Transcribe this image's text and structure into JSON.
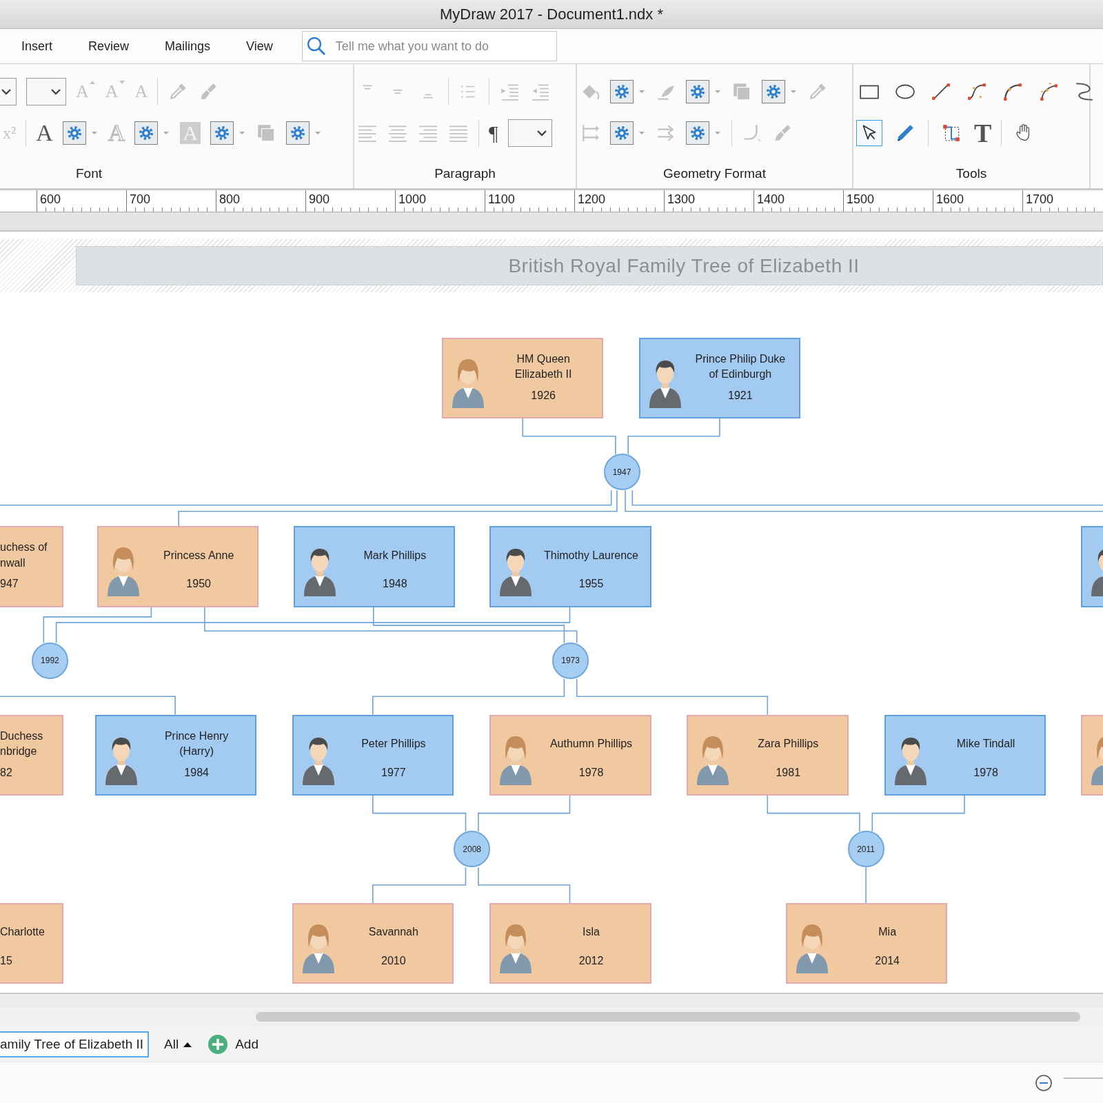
{
  "window": {
    "title": "MyDraw 2017 - Document1.ndx *"
  },
  "menu": [
    {
      "label": "Insert"
    },
    {
      "label": "Review"
    },
    {
      "label": "Mailings"
    },
    {
      "label": "View"
    }
  ],
  "search": {
    "placeholder": "Tell me what you want to do"
  },
  "ribbon": {
    "groups": [
      {
        "label": "Font",
        "toolbars": [
          {
            "tools": [
              {
                "kind": "dropdown-cut"
              },
              {
                "kind": "dropdown"
              },
              {
                "kind": "grow-font",
                "glyph": "A",
                "disabled": true
              },
              {
                "kind": "shrink-font",
                "glyph": "A",
                "disabled": true
              },
              {
                "kind": "clear-format",
                "glyph": "A",
                "disabled": true
              },
              {
                "kind": "separator"
              },
              {
                "kind": "eyedropper",
                "disabled": true
              },
              {
                "kind": "brush",
                "disabled": true
              }
            ]
          },
          {
            "tools": [
              {
                "kind": "superscript",
                "glyph": "x²",
                "disabled": true
              },
              {
                "kind": "separator"
              },
              {
                "kind": "letter",
                "glyph": "A"
              },
              {
                "kind": "gear-dropdown"
              },
              {
                "kind": "letter-outline",
                "glyph": "A",
                "disabled": true
              },
              {
                "kind": "gear-dropdown"
              },
              {
                "kind": "letter-block",
                "glyph": "A",
                "disabled": true
              },
              {
                "kind": "gear-dropdown"
              },
              {
                "kind": "shadow",
                "disabled": true
              },
              {
                "kind": "gear-dropdown"
              }
            ]
          }
        ]
      },
      {
        "label": "Paragraph",
        "toolbars": [
          {
            "tools": [
              {
                "kind": "align-top",
                "disabled": true
              },
              {
                "kind": "align-middle",
                "disabled": true
              },
              {
                "kind": "align-bottom",
                "disabled": true
              },
              {
                "kind": "separator"
              },
              {
                "kind": "bullets",
                "disabled": true
              },
              {
                "kind": "separator"
              },
              {
                "kind": "indent",
                "disabled": true
              },
              {
                "kind": "outdent",
                "disabled": true
              }
            ]
          },
          {
            "tools": [
              {
                "kind": "align-left",
                "disabled": true
              },
              {
                "kind": "align-center",
                "disabled": true
              },
              {
                "kind": "align-right",
                "disabled": true
              },
              {
                "kind": "justify",
                "disabled": true
              },
              {
                "kind": "separator"
              },
              {
                "kind": "pilcrow",
                "glyph": "¶"
              },
              {
                "kind": "dropdown"
              }
            ]
          }
        ]
      },
      {
        "label": "Geometry Format",
        "toolbars": [
          {
            "tools": [
              {
                "kind": "fill-bucket",
                "disabled": true
              },
              {
                "kind": "gear-dropdown"
              },
              {
                "kind": "line-brush",
                "disabled": true
              },
              {
                "kind": "gear-dropdown"
              },
              {
                "kind": "shadow",
                "disabled": true
              },
              {
                "kind": "gear-dropdown"
              },
              {
                "kind": "eyedropper",
                "disabled": true
              }
            ]
          },
          {
            "tools": [
              {
                "kind": "arrow-heads",
                "disabled": true
              },
              {
                "kind": "gear-dropdown"
              },
              {
                "kind": "arrows",
                "disabled": true
              },
              {
                "kind": "gear-dropdown"
              },
              {
                "kind": "separator"
              },
              {
                "kind": "corner",
                "disabled": true
              },
              {
                "kind": "brush",
                "disabled": true
              }
            ]
          }
        ]
      },
      {
        "label": "Tools",
        "toolbars": [
          {
            "tools": [
              {
                "kind": "rectangle",
                "selected": false
              },
              {
                "kind": "ellipse",
                "selected": false
              },
              {
                "kind": "line",
                "selected": false
              },
              {
                "kind": "bezier",
                "selected": false
              },
              {
                "kind": "arc",
                "selected": false
              },
              {
                "kind": "curve",
                "selected": false
              },
              {
                "kind": "squiggle",
                "selected": false
              }
            ]
          },
          {
            "tools": [
              {
                "kind": "pointer",
                "selected": true
              },
              {
                "kind": "pencil",
                "selected": false
              },
              {
                "kind": "separator"
              },
              {
                "kind": "connector",
                "selected": false
              },
              {
                "kind": "text-tool",
                "glyph": "T",
                "selected": false
              },
              {
                "kind": "separator"
              },
              {
                "kind": "hand",
                "selected": false
              }
            ]
          }
        ]
      }
    ]
  },
  "ruler": [
    "600",
    "700",
    "800",
    "900",
    "1000",
    "1100",
    "1200",
    "1300",
    "1400",
    "1500",
    "1600",
    "1700"
  ],
  "diagram": {
    "title": "British Royal Family Tree of Elizabeth II",
    "people": [
      {
        "name": "HM Queen\nEllizabeth II",
        "year": "1926",
        "kind": "female",
        "clipped": false
      },
      {
        "name": "Prince Philip Duke\nof Edinburgh",
        "year": "1921",
        "kind": "male",
        "clipped": false
      },
      {
        "name": "uchess of\nnwall",
        "year": "947",
        "kind": "female",
        "clipped": true
      },
      {
        "name": "Princess Anne",
        "year": "1950",
        "kind": "female",
        "clipped": false
      },
      {
        "name": "Mark Phillips",
        "year": "1948",
        "kind": "male",
        "clipped": false
      },
      {
        "name": "Thimothy Laurence",
        "year": "1955",
        "kind": "male",
        "clipped": false
      },
      {
        "kind": "male",
        "clipped": false
      },
      {
        "name": "Duchess\nnbridge",
        "year": "82",
        "kind": "female",
        "clipped": true
      },
      {
        "name": "Prince Henry\n(Harry)",
        "year": "1984",
        "kind": "male",
        "clipped": false
      },
      {
        "name": "Peter Phillips",
        "year": "1977",
        "kind": "male",
        "clipped": false
      },
      {
        "name": "Authumn Phillips",
        "year": "1978",
        "kind": "female",
        "clipped": false
      },
      {
        "name": "Zara Phillips",
        "year": "1981",
        "kind": "female",
        "clipped": false
      },
      {
        "name": "Mike Tindall",
        "year": "1978",
        "kind": "male",
        "clipped": false
      },
      {
        "kind": "female",
        "clipped": false
      },
      {
        "name": "Charlotte",
        "year": "15",
        "kind": "female",
        "clipped": true
      },
      {
        "name": "Savannah",
        "year": "2010",
        "kind": "female",
        "clipped": false
      },
      {
        "name": "Isla",
        "year": "2012",
        "kind": "female",
        "clipped": false
      },
      {
        "name": "Mia",
        "year": "2014",
        "kind": "female",
        "clipped": false
      }
    ],
    "marriages": [
      {
        "year": "1947"
      },
      {
        "year": "1992"
      },
      {
        "year": "1973"
      },
      {
        "year": "2008"
      },
      {
        "year": "2011"
      }
    ]
  },
  "page_tabs": [
    {
      "label": "amily Tree of Elizabeth II",
      "selected": true
    }
  ],
  "layer_filter": {
    "label": "All"
  },
  "add_button": {
    "label": "Add"
  }
}
